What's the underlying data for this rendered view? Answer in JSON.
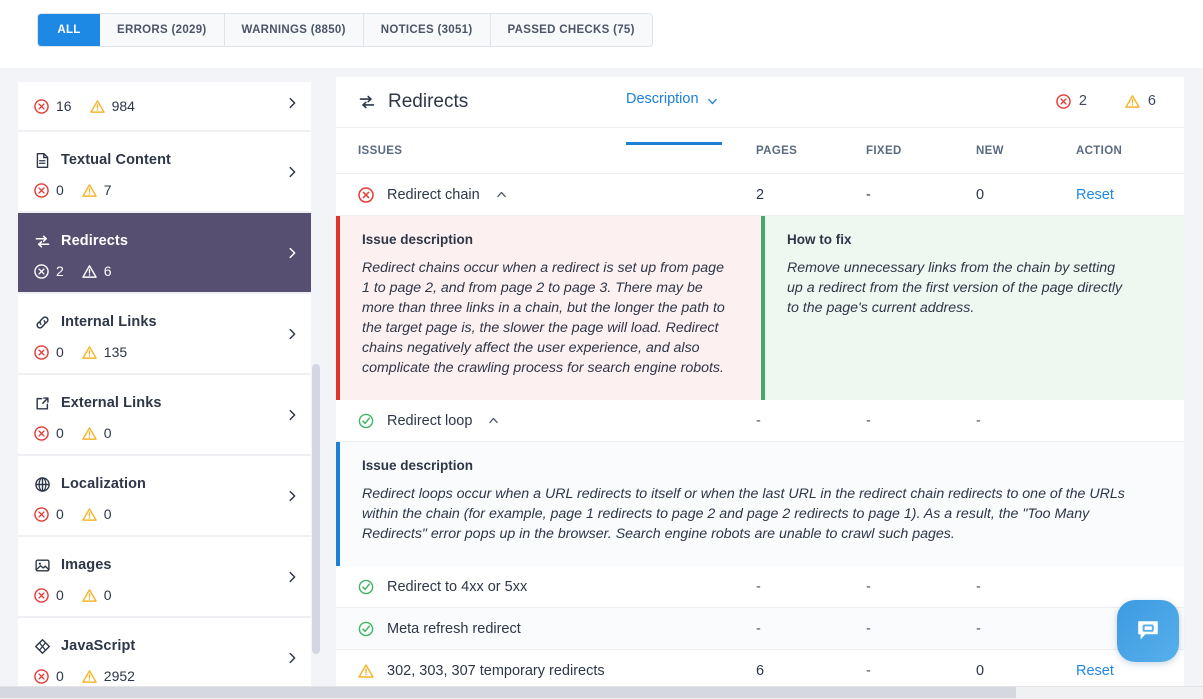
{
  "tabs": [
    {
      "label": "ALL",
      "active": true
    },
    {
      "label": "ERRORS (2029)",
      "active": false
    },
    {
      "label": "WARNINGS (8850)",
      "active": false
    },
    {
      "label": "NOTICES (3051)",
      "active": false
    },
    {
      "label": "PASSED CHECKS (75)",
      "active": false
    }
  ],
  "sidebar": {
    "items": [
      {
        "icon": "partial-icon",
        "label": "",
        "errors": "16",
        "warnings": "984",
        "active": false,
        "partial": true
      },
      {
        "icon": "document-icon",
        "label": "Textual Content",
        "errors": "0",
        "warnings": "7",
        "active": false,
        "partial": false
      },
      {
        "icon": "redirects-icon",
        "label": "Redirects",
        "errors": "2",
        "warnings": "6",
        "active": true,
        "partial": false
      },
      {
        "icon": "link-icon",
        "label": "Internal Links",
        "errors": "0",
        "warnings": "135",
        "active": false,
        "partial": false
      },
      {
        "icon": "external-link-icon",
        "label": "External Links",
        "errors": "0",
        "warnings": "0",
        "active": false,
        "partial": false
      },
      {
        "icon": "globe-icon",
        "label": "Localization",
        "errors": "0",
        "warnings": "0",
        "active": false,
        "partial": false
      },
      {
        "icon": "image-icon",
        "label": "Images",
        "errors": "0",
        "warnings": "0",
        "active": false,
        "partial": false
      },
      {
        "icon": "javascript-icon",
        "label": "JavaScript",
        "errors": "0",
        "warnings": "2952",
        "active": false,
        "partial": false
      }
    ]
  },
  "main": {
    "title": "Redirects",
    "description_tab": "Description",
    "errors_count": "2",
    "warnings_count": "6",
    "columns": {
      "issues": "ISSUES",
      "pages": "PAGES",
      "fixed": "FIXED",
      "new": "NEW",
      "action": "ACTION"
    },
    "rows": [
      {
        "status": "error",
        "name": "Redirect chain",
        "expandable": true,
        "expanded": true,
        "pages": "2",
        "fixed": "-",
        "new": "0",
        "action": "Reset",
        "detail": {
          "type": "split",
          "left_heading": "Issue description",
          "left_body": "Redirect chains occur when a redirect is set up from page 1 to page 2, and from page 2 to page 3. There may be more than three links in a chain, but the longer the path to the target page is, the slower the page will load. Redirect chains negatively affect the user experience, and also complicate the crawling process for search engine robots.",
          "right_heading": "How to fix",
          "right_body": "Remove unnecessary links from the chain by setting up a redirect from the first version of the page directly to the page's current address."
        }
      },
      {
        "status": "passed",
        "name": "Redirect loop",
        "expandable": true,
        "expanded": true,
        "pages": "-",
        "fixed": "-",
        "new": "-",
        "action": "",
        "detail": {
          "type": "full",
          "left_heading": "Issue description",
          "left_body": "Redirect loops occur when a URL redirects to itself or when the last URL in the redirect chain redirects to one of the URLs within the chain (for example, page 1 redirects to page 2 and page 2 redirects to page 1). As a result, the \"Too Many Redirects\" error pops up in the browser. Search engine robots are unable to crawl such pages."
        }
      },
      {
        "status": "passed",
        "name": "Redirect to 4xx or 5xx",
        "expandable": false,
        "expanded": false,
        "pages": "-",
        "fixed": "-",
        "new": "-",
        "action": ""
      },
      {
        "status": "passed",
        "name": "Meta refresh redirect",
        "expandable": false,
        "expanded": false,
        "pages": "-",
        "fixed": "-",
        "new": "-",
        "action": ""
      },
      {
        "status": "warning",
        "name": "302, 303, 307 temporary redirects",
        "expandable": false,
        "expanded": false,
        "pages": "6",
        "fixed": "-",
        "new": "0",
        "action": "Reset"
      }
    ]
  },
  "chat": {
    "icon": "chat-bubble-icon"
  },
  "colors": {
    "accent_blue": "#1e88e5",
    "active_sidebar": "#564f72",
    "error_red": "#e53935",
    "warning_yellow": "#f5b52c",
    "success_green": "#3eb563",
    "desc_bar_red": "#e0342c",
    "desc_bar_green": "#4aa76a",
    "desc_bar_blue": "#1e7fd6"
  }
}
